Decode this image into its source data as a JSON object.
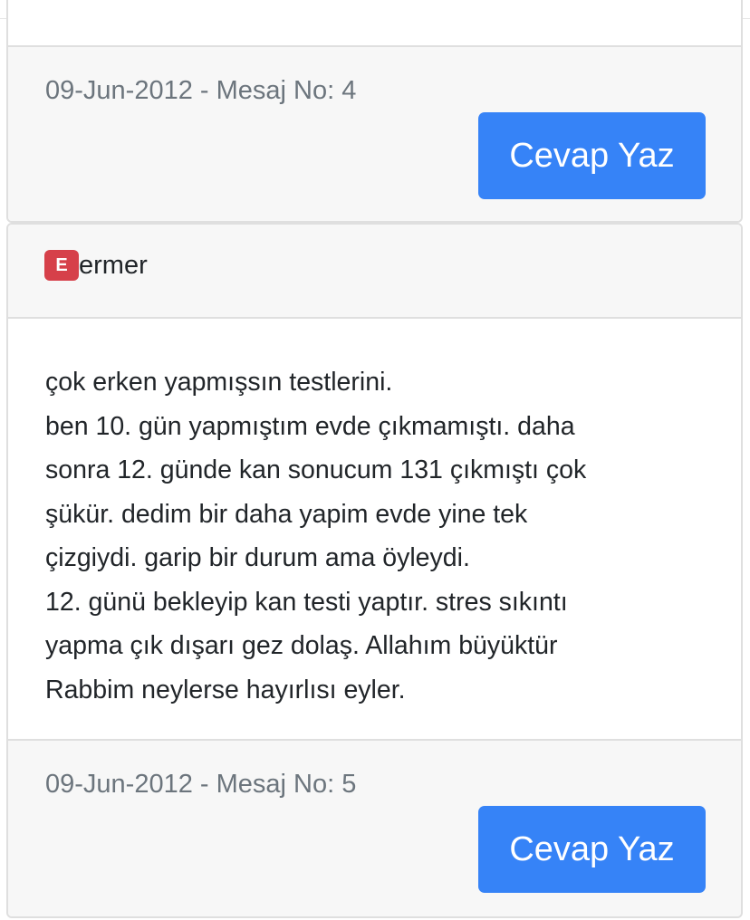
{
  "post4": {
    "meta": "09-Jun-2012 - Mesaj No: 4",
    "reply_label": "Cevap Yaz"
  },
  "post5": {
    "avatar_letter": "E",
    "username": "ermer",
    "message_lines": [
      "çok erken yapmışsın testlerini.",
      "ben 10. gün yapmıştım evde çıkmamıştı. daha",
      "sonra 12. günde kan sonucum 131 çıkmıştı çok",
      "şükür. dedim bir daha yapim evde yine tek",
      "çizgiydi. garip bir durum ama öyleydi.",
      "12. günü bekleyip kan testi yaptır. stres sıkıntı",
      "yapma çık dışarı gez dolaş. Allahım büyüktür",
      "Rabbim neylerse hayırlısı eyler."
    ],
    "meta": "09-Jun-2012 - Mesaj No: 5",
    "reply_label": "Cevap Yaz"
  },
  "colors": {
    "button": "#3683f7",
    "avatar": "#d6404a",
    "meta_text": "#6c757d",
    "footer_bg": "#f7f7f7"
  }
}
